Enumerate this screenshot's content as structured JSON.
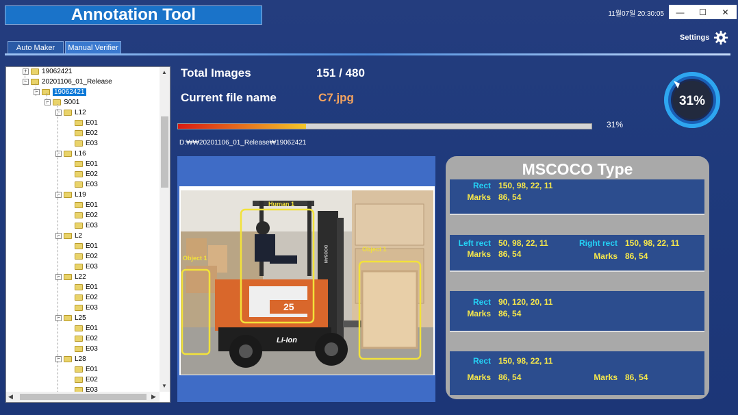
{
  "app": {
    "title": "Annotation Tool",
    "clock": "11월07일 20:30:05"
  },
  "window_controls": {
    "minimize": "—",
    "maximize": "☐",
    "close": "✕"
  },
  "settings": {
    "label": "Settings"
  },
  "tabs": [
    {
      "label": "Auto Maker"
    },
    {
      "label": "Manual Verifier",
      "active": true
    }
  ],
  "tree": {
    "root1": "19062421",
    "root2": "20201106_01_Release",
    "child": "19062421",
    "s001": "S001",
    "groups": [
      {
        "name": "L12",
        "items": [
          "E01",
          "E02",
          "E03"
        ]
      },
      {
        "name": "L16",
        "items": [
          "E01",
          "E02",
          "E03"
        ]
      },
      {
        "name": "L19",
        "items": [
          "E01",
          "E02",
          "E03"
        ]
      },
      {
        "name": "L2",
        "items": [
          "E01",
          "E02",
          "E03"
        ]
      },
      {
        "name": "L22",
        "items": [
          "E01",
          "E02",
          "E03"
        ]
      },
      {
        "name": "L25",
        "items": [
          "E01",
          "E02",
          "E03"
        ]
      },
      {
        "name": "L28",
        "items": [
          "E01",
          "E02",
          "E03"
        ]
      }
    ]
  },
  "info": {
    "total_label": "Total Images",
    "total_value": "151 / 480",
    "file_label": "Current file name",
    "file_value": "C7.jpg",
    "progress": 0.31,
    "progress_text": "31%",
    "path": "D:₩₩20201106_01_Release₩19062421",
    "ring_text": "31%"
  },
  "image": {
    "labels": {
      "human": "Human 1",
      "object_left": "Object 1",
      "object_right": "Object 1"
    },
    "forklift_model": "25",
    "forklift_badge": "Li-Ion",
    "mast_brand": "DOOSAN",
    "box_color": "#f2e23a"
  },
  "coco": {
    "title": "MSCOCO Type",
    "cards": [
      {
        "rect_label": "Rect",
        "rect": "150, 98, 22, 11",
        "marks_label": "Marks",
        "marks": "86, 54"
      },
      {
        "left_label": "Left rect",
        "left": "50, 98, 22, 11",
        "right_label": "Right rect",
        "right": "150, 98, 22, 11",
        "marks_label": "Marks",
        "marks_left": "86, 54",
        "marks_right": "86, 54"
      },
      {
        "rect_label": "Rect",
        "rect": "90, 120, 20, 11",
        "marks_label": "Marks",
        "marks": "86, 54"
      },
      {
        "rect_label": "Rect",
        "rect": "150, 98, 22, 11",
        "marks_label": "Marks",
        "marks_left": "86, 54",
        "marks_right": "86, 54"
      }
    ]
  },
  "colors": {
    "background": "#1f3a7c",
    "title_bar": "#1a73c9",
    "label": "#24d2f6",
    "value": "#f7e84b"
  }
}
